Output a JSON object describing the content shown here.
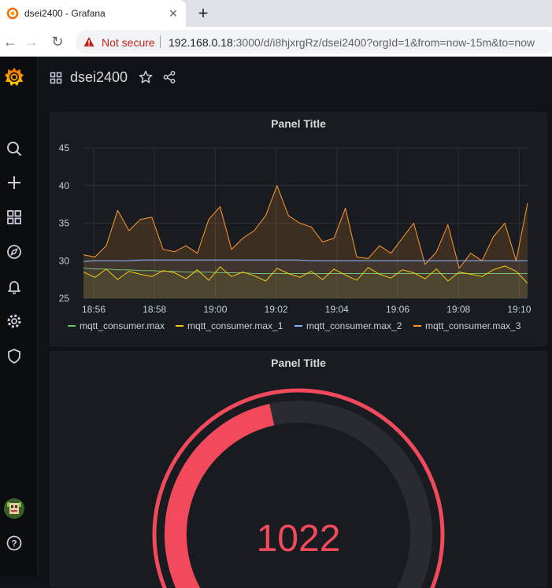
{
  "browser": {
    "tab_title": "dsei2400 - Grafana",
    "security_label": "Not secure",
    "url_host": "192.168.0.18",
    "url_rest": ":3000/d/i8hjxrgRz/dsei2400?orgId=1&from=now-15m&to=now"
  },
  "dashboard": {
    "title": "dsei2400"
  },
  "sidemenu": {
    "icons": [
      "grafana-logo",
      "search-icon",
      "plus-icon",
      "dashboards-icon",
      "explore-icon",
      "alerting-icon",
      "configuration-icon",
      "shield-icon",
      "avatar",
      "help-icon"
    ]
  },
  "panels": {
    "graph": {
      "title": "Panel Title",
      "legend": [
        "mqtt_consumer.max",
        "mqtt_consumer.max_1",
        "mqtt_consumer.max_2",
        "mqtt_consumer.max_3"
      ]
    },
    "gauge": {
      "title": "Panel Title",
      "value": "1022",
      "fill_fraction": 0.45,
      "color": "#f2495c"
    }
  },
  "chart_data": {
    "type": "line",
    "title": "Panel Title",
    "x_ticks": [
      "18:56",
      "18:58",
      "19:00",
      "19:02",
      "19:04",
      "19:06",
      "19:08",
      "19:10"
    ],
    "y_ticks": [
      25,
      30,
      35,
      40,
      45
    ],
    "ylim": [
      25,
      45
    ],
    "grid": true,
    "legend_position": "bottom",
    "series": [
      {
        "name": "mqtt_consumer.max",
        "color": "#73bf69",
        "values": [
          29,
          28.9,
          28.9,
          28.8,
          28.8,
          28.7,
          28.7,
          28.6,
          28.6,
          28.5,
          28.5,
          28.5,
          28.4,
          28.4,
          28.4,
          28.3,
          28.3,
          28.3,
          28.3,
          28.3,
          28.3,
          28.3,
          28.3,
          28.3,
          28.3,
          28.3,
          28.3,
          28.3,
          28.3,
          28.3,
          28.3,
          28.3,
          28.3,
          28.3,
          28.3,
          28.3,
          28.3,
          28.3,
          28.3,
          28.3
        ]
      },
      {
        "name": "mqtt_consumer.max_1",
        "color": "#f2cc0c",
        "values": [
          28.5,
          27.8,
          28.9,
          27.5,
          28.6,
          28.2,
          27.9,
          28.7,
          28.4,
          27.6,
          28.8,
          27.4,
          29.2,
          27.9,
          28.5,
          28.0,
          27.3,
          29.0,
          28.3,
          27.8,
          28.6,
          27.5,
          28.9,
          28.1,
          27.4,
          29.1,
          28.2,
          27.7,
          28.8,
          28.4,
          27.6,
          28.9,
          27.3,
          28.5,
          28.2,
          27.9,
          28.8,
          29.3,
          28.6,
          27.0
        ]
      },
      {
        "name": "mqtt_consumer.max_2",
        "color": "#8ab8ff",
        "values": [
          29.9,
          30.0,
          30.0,
          30.0,
          30.0,
          30.1,
          30.1,
          30.1,
          30.1,
          30.1,
          30.1,
          30.1,
          30.1,
          30.1,
          30.1,
          30.1,
          30.1,
          30.1,
          30.1,
          30.1,
          30.0,
          30.0,
          30.0,
          30.0,
          30.0,
          30.0,
          30.0,
          30.0,
          30.0,
          30.0,
          30.0,
          30.0,
          30.0,
          30.0,
          30.0,
          30.0,
          30.0,
          30.0,
          30.0,
          30.0
        ]
      },
      {
        "name": "mqtt_consumer.max_3",
        "color": "#ff9830",
        "values": [
          30.8,
          30.5,
          32.0,
          36.7,
          34.0,
          35.5,
          35.8,
          31.5,
          31.2,
          32.0,
          31.0,
          35.5,
          37.2,
          31.5,
          33.0,
          34.0,
          36.0,
          40.0,
          36.0,
          35.0,
          34.5,
          32.5,
          33.0,
          37.0,
          30.5,
          30.3,
          32.0,
          31.0,
          33.0,
          35.0,
          29.5,
          31.2,
          34.8,
          29.0,
          31.0,
          30.0,
          33.2,
          35.0,
          30.0,
          37.7
        ]
      }
    ]
  }
}
